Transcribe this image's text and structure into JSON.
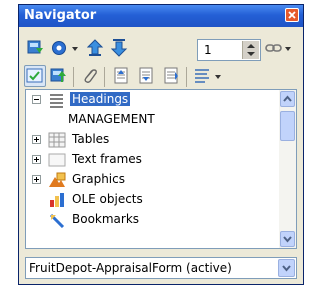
{
  "window": {
    "title": "Navigator"
  },
  "toolbar": {
    "page_number": "1"
  },
  "tree": {
    "items": [
      {
        "label": "Headings",
        "expander": "minus",
        "icon": "headings-icon",
        "selected": true
      },
      {
        "label": "MANAGEMENT",
        "expander": "none",
        "icon": "none",
        "selected": false
      },
      {
        "label": "Tables",
        "expander": "plus",
        "icon": "table-icon",
        "selected": false
      },
      {
        "label": "Text frames",
        "expander": "plus",
        "icon": "text-frame-icon",
        "selected": false
      },
      {
        "label": "Graphics",
        "expander": "plus",
        "icon": "graphics-icon",
        "selected": false
      },
      {
        "label": "OLE objects",
        "expander": "none",
        "icon": "ole-object-icon",
        "selected": false
      },
      {
        "label": "Bookmarks",
        "expander": "none",
        "icon": "bookmark-icon",
        "selected": false
      }
    ]
  },
  "document_selector": {
    "value": "FruitDepot-AppraisalForm (active)"
  },
  "colors": {
    "titlebar": "#2460d6",
    "window_bg": "#ece9d8",
    "selection": "#316ac5",
    "close": "#e65a2c"
  }
}
